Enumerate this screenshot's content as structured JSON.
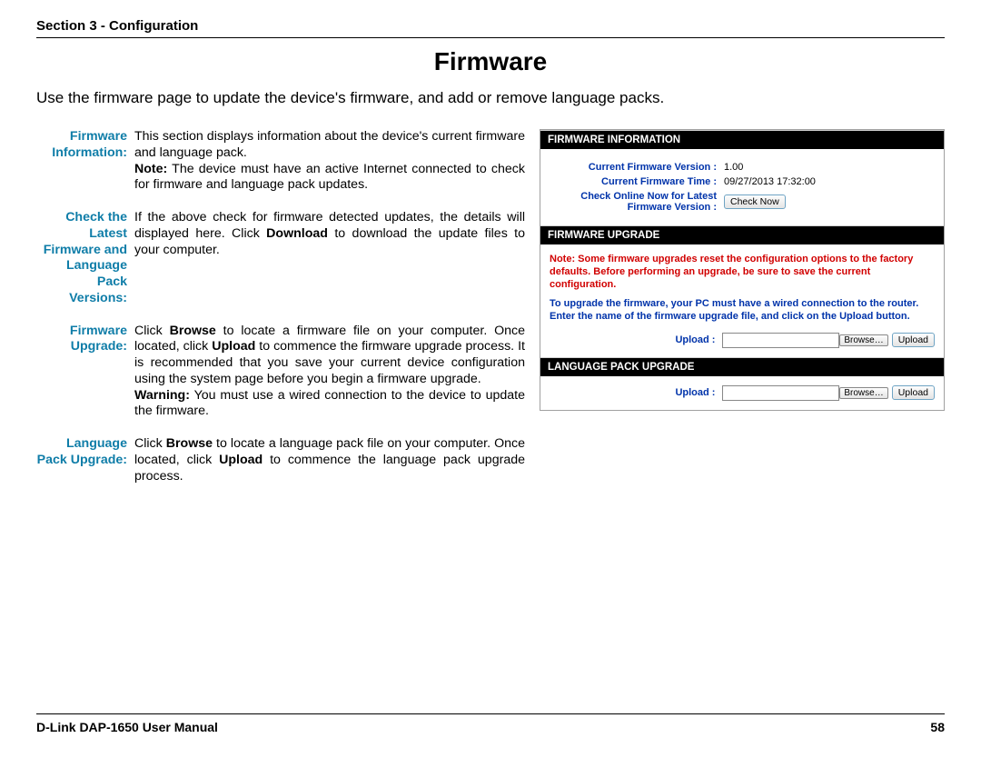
{
  "header": {
    "section": "Section 3 - Configuration"
  },
  "title": "Firmware",
  "intro": "Use the firmware page to update the device's firmware, and add or remove language packs.",
  "defs": {
    "fw_info": {
      "label": "Firmware Information:",
      "body_lead": "This section displays information about the device's current firmware and language pack.",
      "note_label": "Note:",
      "note_body": " The device must have an active Internet connected to check for firmware and language pack updates."
    },
    "check_latest": {
      "label": "Check the Latest Firmware and Language Pack Versions:",
      "body_lead": "If the above check for firmware detected updates, the details will displayed here. Click ",
      "bold1": "Download",
      "body_tail": " to download the update files to your computer."
    },
    "fw_upgrade": {
      "label": "Firmware Upgrade:",
      "p1a": "Click ",
      "p1b": "Browse",
      "p1c": " to locate a firmware file on your computer. Once located, click ",
      "p1d": "Upload",
      "p1e": " to commence the firmware upgrade process. It is recommended that you save your current device configuration using the system page before you begin a firmware upgrade.",
      "warn_label": "Warning:",
      "warn_body": " You must use a wired connection to the device to update the firmware."
    },
    "lang_upgrade": {
      "label": "Language Pack Upgrade:",
      "p1a": "Click ",
      "p1b": "Browse",
      "p1c": " to locate a language pack file on your computer. Once located, click ",
      "p1d": "Upload",
      "p1e": " to commence the language pack upgrade process."
    }
  },
  "panel": {
    "sect1": {
      "head": "FIRMWARE INFORMATION",
      "ver_label": "Current Firmware Version  :",
      "ver_value": "1.00",
      "time_label": "Current Firmware Time  :",
      "time_value": "09/27/2013 17:32:00",
      "check_label": "Check Online Now for Latest Firmware Version  :",
      "check_btn": "Check Now"
    },
    "sect2": {
      "head": "FIRMWARE UPGRADE",
      "red": "Note: Some firmware upgrades reset the configuration options to the factory defaults. Before performing an upgrade, be sure to save the current configuration.",
      "blue": "To upgrade the firmware, your PC must have a wired connection to the router. Enter the name of the firmware upgrade file, and click on the Upload button.",
      "upload_label": "Upload  :",
      "browse_btn": "Browse…",
      "upload_btn": "Upload"
    },
    "sect3": {
      "head": "LANGUAGE PACK UPGRADE",
      "upload_label": "Upload  :",
      "browse_btn": "Browse…",
      "upload_btn": "Upload"
    }
  },
  "footer": {
    "left": "D-Link DAP-1650 User Manual",
    "right": "58"
  }
}
